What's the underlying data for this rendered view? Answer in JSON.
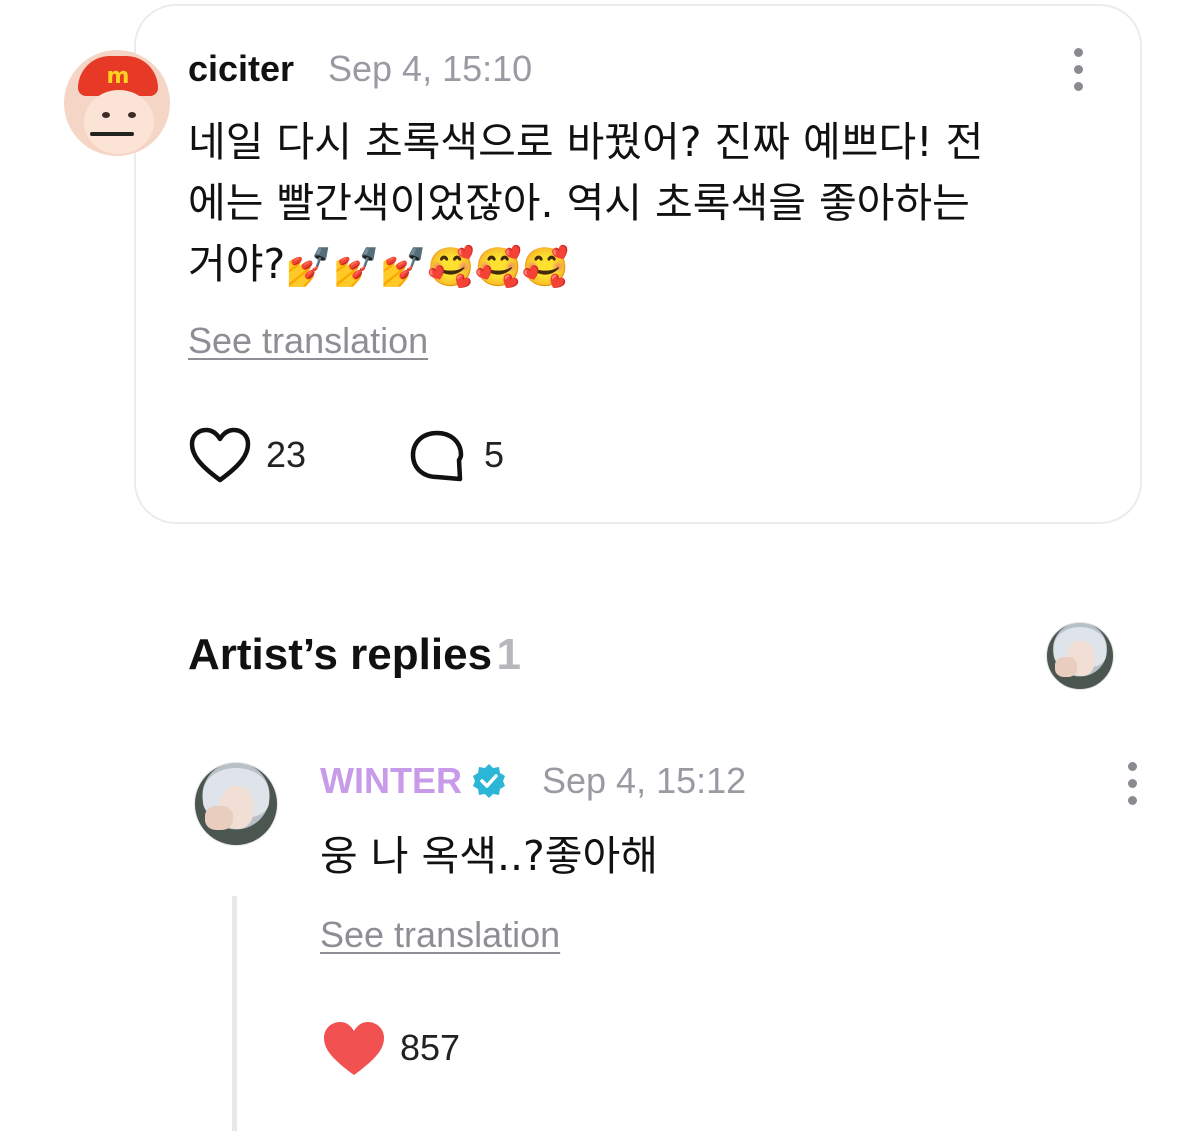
{
  "post": {
    "username": "ciciter",
    "timestamp": "Sep 4, 15:10",
    "text_line1": "네일 다시 초록색으로 바꿨어? 진짜 예쁘다! 전",
    "text_line2": "에는 빨간색이었잖아. 역시 초록색을 좋아하는",
    "text_line3_prefix": "거야?",
    "emojis": [
      "💅",
      "💅",
      "💅",
      "🥰",
      "🥰",
      "🥰"
    ],
    "see_translation": "See translation",
    "like_count": "23",
    "comment_count": "5"
  },
  "artist_replies": {
    "title": "Artist’s replies",
    "count": "1"
  },
  "reply": {
    "username": "WINTER",
    "verified": true,
    "timestamp": "Sep 4, 15:12",
    "text": "웅 나 옥색..?좋아해",
    "see_translation": "See translation",
    "like_count": "857"
  },
  "colors": {
    "artist_name": "#c79be9",
    "verified_badge": "#2bb5d6",
    "liked_heart": "#f25151"
  },
  "icons": {
    "like": "heart-outline-icon",
    "comment": "speech-bubble-icon",
    "liked": "heart-filled-icon",
    "verified": "verified-badge-icon",
    "more": "more-vertical-icon"
  }
}
